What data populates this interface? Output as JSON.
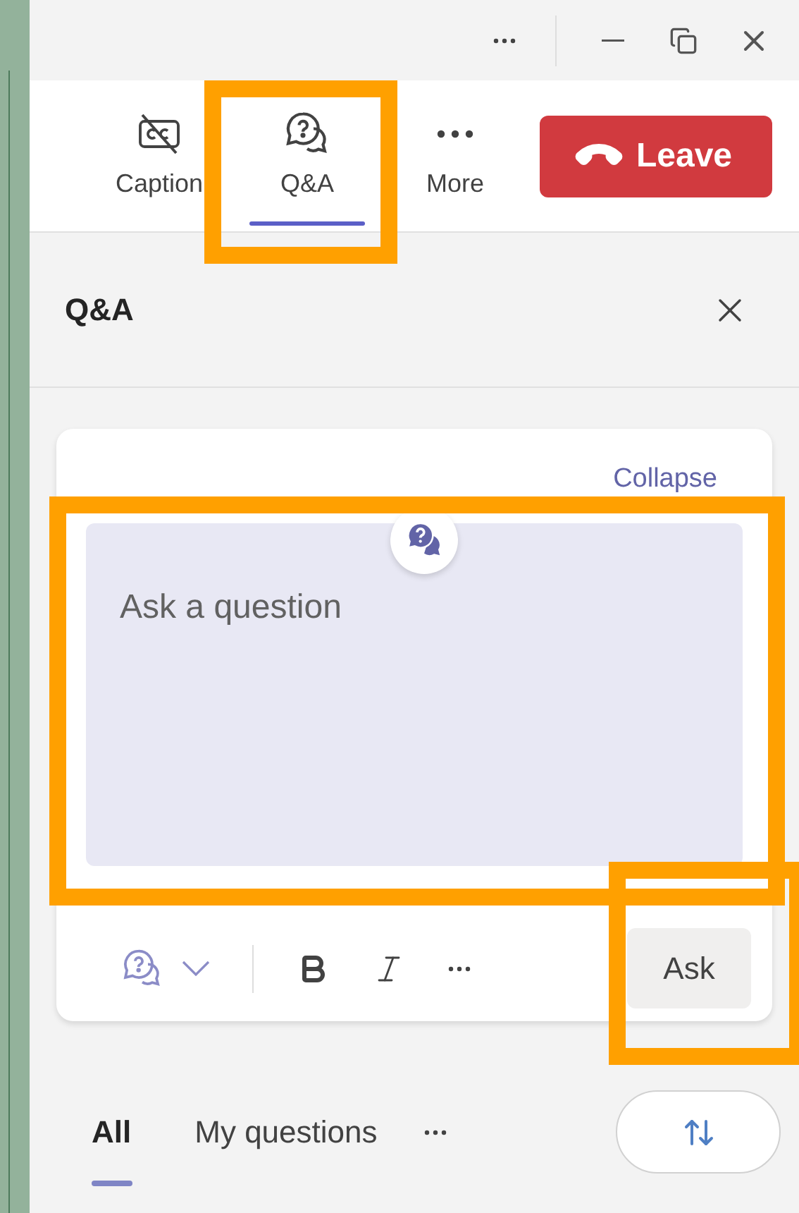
{
  "toolbar": {
    "items": [
      {
        "kind": "captions",
        "label": "Caption",
        "selected": false
      },
      {
        "kind": "qa",
        "label": "Q&A",
        "selected": true
      },
      {
        "kind": "more",
        "label": "More",
        "selected": false
      }
    ],
    "leave": "Leave"
  },
  "panel": {
    "title": "Q&A",
    "collapse": "Collapse",
    "composer": {
      "placeholder": "Ask a question",
      "ask": "Ask"
    },
    "tabs": [
      {
        "label": "All",
        "selected": true
      },
      {
        "label": "My questions",
        "selected": false
      }
    ]
  }
}
